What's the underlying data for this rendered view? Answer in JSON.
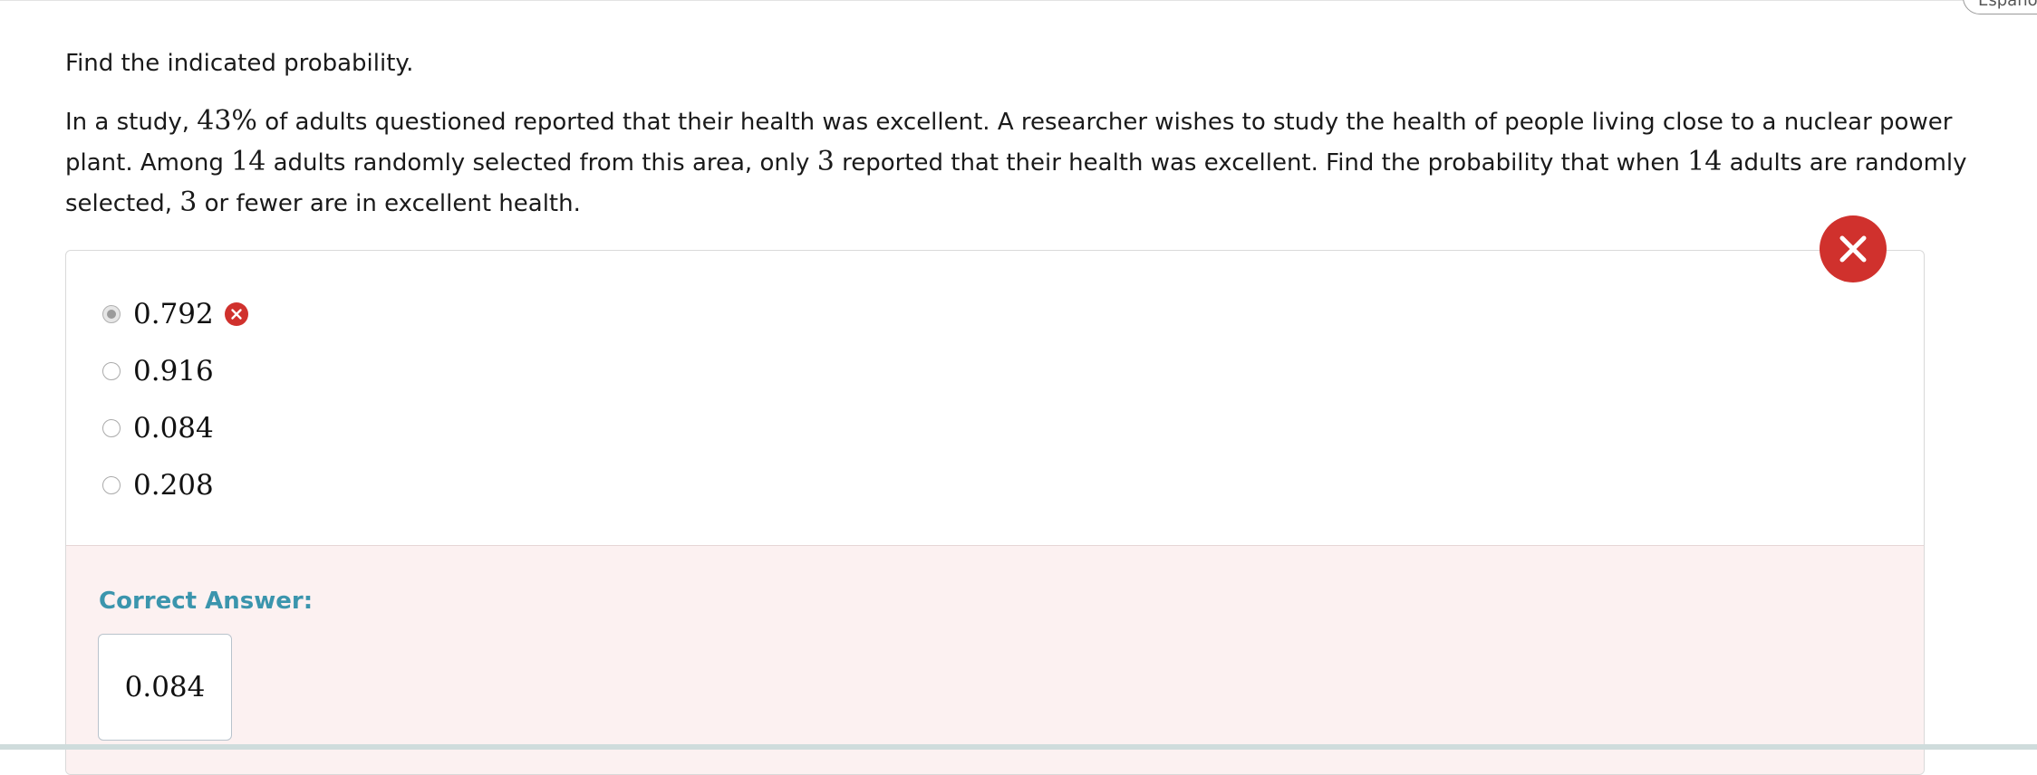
{
  "header": {
    "language_button": "Español"
  },
  "question": {
    "instruction": "Find the indicated probability.",
    "problem_parts": {
      "p1": "In a study, ",
      "pct": "43%",
      "p2": " of adults questioned reported that their health was excellent. A researcher wishes to study the health of people living close to a nuclear power plant. Among ",
      "n1": "14",
      "p3": " adults randomly selected from this area, only ",
      "k1": "3",
      "p4": " reported that their health was excellent. Find the probability that when ",
      "n2": "14",
      "p5": " adults are randomly selected, ",
      "k2": "3",
      "p6": " or fewer are in excellent health."
    }
  },
  "options": [
    {
      "label": "0.792",
      "selected": true,
      "marked_wrong": true
    },
    {
      "label": "0.916",
      "selected": false,
      "marked_wrong": false
    },
    {
      "label": "0.084",
      "selected": false,
      "marked_wrong": false
    },
    {
      "label": "0.208",
      "selected": false,
      "marked_wrong": false
    }
  ],
  "feedback": {
    "correct_answer_label": "Correct Answer:",
    "correct_answer_value": "0.084",
    "status": "incorrect"
  },
  "icons": {
    "incorrect_status": "close-icon",
    "option_wrong": "close-icon"
  },
  "colors": {
    "incorrect_red": "#d0312d",
    "correct_label": "#3b95ad",
    "feedback_background": "#fcf1f1"
  }
}
